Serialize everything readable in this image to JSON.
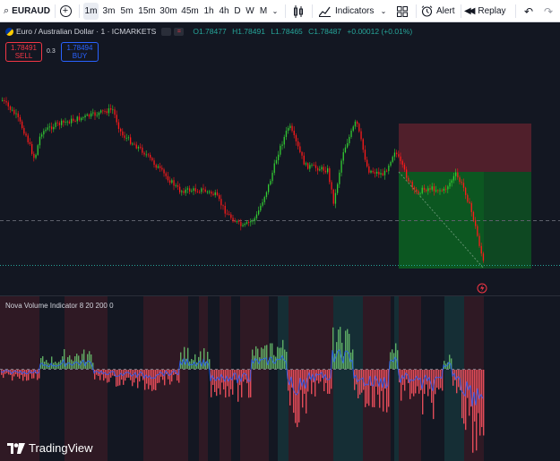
{
  "toolbar": {
    "symbol": "EURAUD",
    "timeframes": [
      "1m",
      "3m",
      "5m",
      "15m",
      "30m",
      "45m",
      "1h",
      "4h",
      "D",
      "W",
      "M"
    ],
    "active_timeframe": "1m",
    "indicators_label": "Indicators",
    "alert_label": "Alert",
    "replay_label": "Replay"
  },
  "legend": {
    "title": "Euro / Australian Dollar · 1 · ICMARKETS",
    "open": "O1.78477",
    "high": "H1.78491",
    "low": "L1.78465",
    "close": "C1.78487",
    "change": "+0.00012 (+0.01%)"
  },
  "order": {
    "sell_price": "1.78491",
    "sell_label": "SELL",
    "spread": "0.3",
    "buy_price": "1.78494",
    "buy_label": "BUY"
  },
  "indicator": {
    "label": "Nova Volume Indicator 8 20 200 0"
  },
  "branding": {
    "name": "TradingView"
  },
  "colors": {
    "up": "#26a69a",
    "down": "#ef5350",
    "candle_up": "#33cc33",
    "candle_down": "#ff1a1a",
    "background": "#131722",
    "accent": "#2962ff"
  }
}
